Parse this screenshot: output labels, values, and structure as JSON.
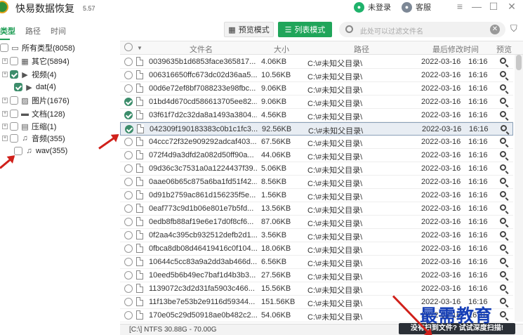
{
  "app": {
    "title": "快易数据恢复",
    "version": "5.57",
    "login": "未登录",
    "service": "客服"
  },
  "window_controls": [
    "≡",
    "—",
    "☐",
    "✕"
  ],
  "left_tabs": [
    "类型",
    "路径",
    "时间"
  ],
  "tree": [
    {
      "label": "所有类型(8058)",
      "checked": false,
      "icon": "monitor-icon",
      "indent": 0
    },
    {
      "label": "其它(5894)",
      "checked": false,
      "icon": "grid-icon",
      "indent": 1
    },
    {
      "label": "视频(4)",
      "checked": true,
      "icon": "play-icon",
      "indent": 1
    },
    {
      "label": "dat(4)",
      "checked": true,
      "icon": "play-icon",
      "indent": 2
    },
    {
      "label": "图片(1676)",
      "checked": false,
      "icon": "image-icon",
      "indent": 1
    },
    {
      "label": "文档(128)",
      "checked": false,
      "icon": "folder-icon",
      "indent": 1
    },
    {
      "label": "压缩(1)",
      "checked": false,
      "icon": "archive-icon",
      "indent": 1
    },
    {
      "label": "音频(355)",
      "checked": false,
      "icon": "music-icon",
      "indent": 1
    },
    {
      "label": "wav(355)",
      "checked": false,
      "icon": "music-icon",
      "indent": 2
    }
  ],
  "toolbar": {
    "preview_mode": "预览模式",
    "list_mode": "列表模式",
    "filter_placeholder": "此处可以过滤文件名"
  },
  "columns": {
    "name": "文件名",
    "size": "大小",
    "path": "路径",
    "modified": "最后修改时间",
    "preview": "预览"
  },
  "files": [
    {
      "name": "0039635b1d6853face365817...",
      "size": "4.06KB",
      "path": "C:\\#未知父目录\\",
      "date": "2022-03-16",
      "time": "16:16",
      "checked": false
    },
    {
      "name": "006316650ffc673dc02d36aa5...",
      "size": "10.56KB",
      "path": "C:\\#未知父目录\\",
      "date": "2022-03-16",
      "time": "16:16",
      "checked": false
    },
    {
      "name": "00d6e72ef8bf7088233e98fbc...",
      "size": "9.06KB",
      "path": "C:\\#未知父目录\\",
      "date": "2022-03-16",
      "time": "16:16",
      "checked": false
    },
    {
      "name": "01bd4d670cd586613705ee82...",
      "size": "9.06KB",
      "path": "C:\\#未知父目录\\",
      "date": "2022-03-16",
      "time": "16:16",
      "checked": true
    },
    {
      "name": "03f61f7d2c32da8a1493a3804...",
      "size": "4.56KB",
      "path": "C:\\#未知父目录\\",
      "date": "2022-03-16",
      "time": "16:16",
      "checked": true
    },
    {
      "name": "042309f190183383c0b1c1fc3...",
      "size": "92.56KB",
      "path": "C:\\#未知父目录\\",
      "date": "2022-03-16",
      "time": "16:16",
      "checked": true,
      "selected": true
    },
    {
      "name": "04ccc72f32e909292adcaf403...",
      "size": "67.56KB",
      "path": "C:\\#未知父目录\\",
      "date": "2022-03-16",
      "time": "16:16",
      "checked": false
    },
    {
      "name": "072f4d9a3dfd2a082d50ff90a...",
      "size": "44.06KB",
      "path": "C:\\#未知父目录\\",
      "date": "2022-03-16",
      "time": "16:16",
      "checked": false
    },
    {
      "name": "09d36c3c7531a0a1224437f39...",
      "size": "5.06KB",
      "path": "C:\\#未知父目录\\",
      "date": "2022-03-16",
      "time": "16:16",
      "checked": false
    },
    {
      "name": "0aae06b65c875a6ba1fd51f42...",
      "size": "8.56KB",
      "path": "C:\\#未知父目录\\",
      "date": "2022-03-16",
      "time": "16:16",
      "checked": false
    },
    {
      "name": "0d91b2759ac861d156235f5e...",
      "size": "1.56KB",
      "path": "C:\\#未知父目录\\",
      "date": "2022-03-16",
      "time": "16:16",
      "checked": false
    },
    {
      "name": "0eaf773c9d1b06e801e7b5fd...",
      "size": "13.56KB",
      "path": "C:\\#未知父目录\\",
      "date": "2022-03-16",
      "time": "16:16",
      "checked": false
    },
    {
      "name": "0edb8fb88af19e6e17d0f8cf6...",
      "size": "87.06KB",
      "path": "C:\\#未知父目录\\",
      "date": "2022-03-16",
      "time": "16:16",
      "checked": false
    },
    {
      "name": "0f2aa4c395cb932512defb2d1...",
      "size": "3.56KB",
      "path": "C:\\#未知父目录\\",
      "date": "2022-03-16",
      "time": "16:16",
      "checked": false
    },
    {
      "name": "0fbca8db08d46419416c0f104...",
      "size": "18.06KB",
      "path": "C:\\#未知父目录\\",
      "date": "2022-03-16",
      "time": "16:16",
      "checked": false
    },
    {
      "name": "10644c5cc83a9a2dd3ab466d...",
      "size": "6.56KB",
      "path": "C:\\#未知父目录\\",
      "date": "2022-03-16",
      "time": "16:16",
      "checked": false
    },
    {
      "name": "10eed5b6b49ec7baf1d4b3b3...",
      "size": "27.56KB",
      "path": "C:\\#未知父目录\\",
      "date": "2022-03-16",
      "time": "16:16",
      "checked": false
    },
    {
      "name": "1139072c3d2d31fa5903c466...",
      "size": "15.56KB",
      "path": "C:\\#未知父目录\\",
      "date": "2022-03-16",
      "time": "16:16",
      "checked": false
    },
    {
      "name": "11f13be7e53b2e9116d59344...",
      "size": "151.56KB",
      "path": "C:\\#未知父目录\\",
      "date": "2022-03-16",
      "time": "16:16",
      "checked": false
    },
    {
      "name": "170e05c29d50918ae0b482c2...",
      "size": "54.06KB",
      "path": "C:\\#未知父目录\\",
      "date": "2022-03-16",
      "time": "16:16",
      "checked": false
    }
  ],
  "status": {
    "disk": "[C:\\] NTFS 30.88G - 70.00G",
    "deep_scan": "没有扫到文件? 试试深度扫描!"
  },
  "watermark": "最需教育",
  "colors": {
    "accent": "#20a55a",
    "arrow": "#d0201a",
    "watermark": "#1740b7"
  }
}
